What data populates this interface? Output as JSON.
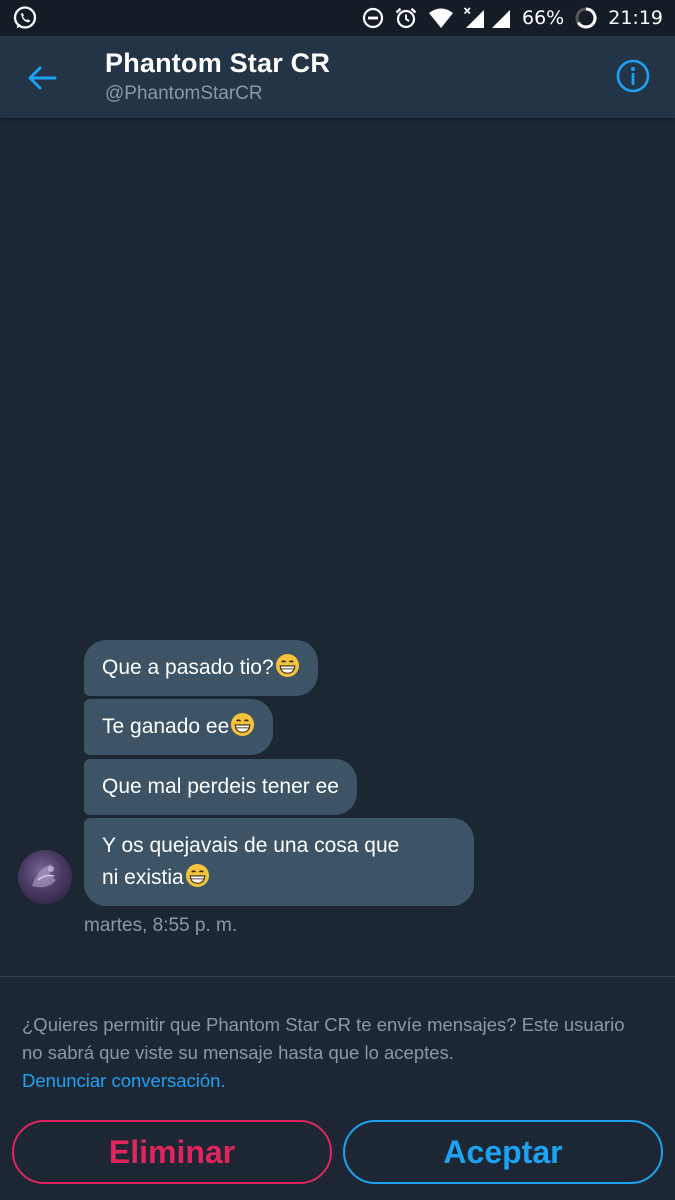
{
  "status_bar": {
    "battery": "66%",
    "time": "21:19",
    "icons": [
      "whatsapp-icon",
      "do-not-disturb-icon",
      "alarm-icon",
      "wifi-icon",
      "signal-icon",
      "battery-icon"
    ]
  },
  "header": {
    "name": "Phantom Star CR",
    "handle": "@PhantomStarCR"
  },
  "messages": [
    {
      "text": "Que a pasado tio?",
      "emoji": "grinning-face-icon"
    },
    {
      "text": "Te ganado ee",
      "emoji": "grinning-face-icon"
    },
    {
      "text": "Que mal perdeis tener ee",
      "emoji": ""
    },
    {
      "text_line1": "Y os quejavais de una cosa que",
      "text_line2": "ni existia",
      "emoji": "grinning-face-icon"
    }
  ],
  "timestamp": "martes, 8:55 p. m.",
  "request": {
    "text": "¿Quieres permitir que Phantom Star CR te envíe mensajes? Este usuario no sabrá que viste su mensaje hasta que lo aceptes.",
    "report_link": "Denunciar conversación.",
    "delete_label": "Eliminar",
    "accept_label": "Aceptar"
  },
  "colors": {
    "background": "#1c2733",
    "header": "#243447",
    "bubble": "#3d5466",
    "accent": "#1da1f2",
    "danger": "#e0245e",
    "muted": "#8899a6"
  }
}
